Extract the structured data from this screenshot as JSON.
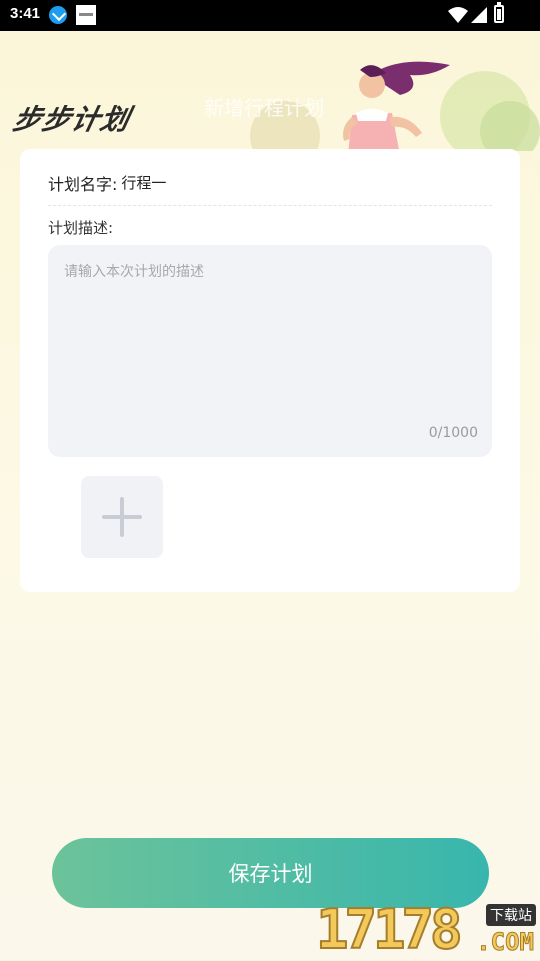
{
  "status_bar": {
    "time": "3:41"
  },
  "header": {
    "brand": "步步计划",
    "title": "新增行程计划"
  },
  "form": {
    "name_label": "计划名字:",
    "name_value": "行程一",
    "desc_label": "计划描述:",
    "desc_placeholder": "请输入本次计划的描述",
    "char_counter": "0/1000"
  },
  "save_button_label": "保存计划",
  "watermark": {
    "number": "17178",
    "tag": "下载站",
    "domain": ".COM"
  },
  "colors": {
    "accent_start": "#6cc39a",
    "accent_end": "#38b6ad",
    "input_bg": "#f2f3f6"
  }
}
